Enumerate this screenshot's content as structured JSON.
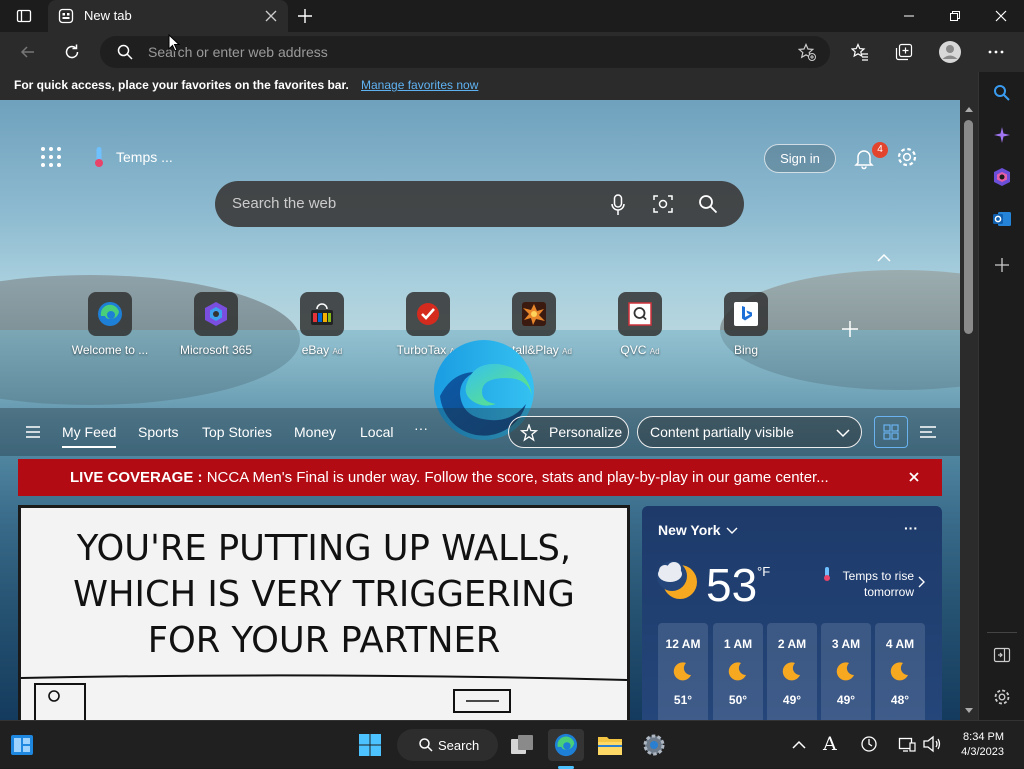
{
  "browser": {
    "tab_title": "New tab",
    "address_placeholder": "Search or enter web address",
    "favbar_text": "For quick access, place your favorites on the favorites bar.",
    "favbar_link": "Manage favorites now"
  },
  "newtab": {
    "weather_temp_label": "Temps ...",
    "sign_in": "Sign in",
    "notification_count": "4",
    "search_placeholder": "Search the web",
    "tiles": [
      {
        "label": "Welcome to ...",
        "ad": "",
        "icon": "edge-icon"
      },
      {
        "label": "Microsoft 365",
        "ad": "",
        "icon": "m365-icon"
      },
      {
        "label": "eBay",
        "ad": "Ad",
        "icon": "ebay-icon"
      },
      {
        "label": "TurboTax",
        "ad": "Ad",
        "icon": "turbotax-icon"
      },
      {
        "label": "Install&Play",
        "ad": "Ad",
        "icon": "install-play-icon"
      },
      {
        "label": "QVC",
        "ad": "Ad",
        "icon": "qvc-icon"
      },
      {
        "label": "Bing",
        "ad": "",
        "icon": "bing-icon"
      }
    ],
    "feed_nav": [
      "My Feed",
      "Sports",
      "Top Stories",
      "Money",
      "Local"
    ],
    "more": "···",
    "personalize": "Personalize",
    "content_visibility": "Content partially visible"
  },
  "banner": {
    "label": "LIVE COVERAGE :",
    "text": "NCCA Men's Final is under way. Follow the score, stats and play-by-play in our game center..."
  },
  "comic": {
    "lines": [
      "YOU'RE PUTTING UP WALLS,",
      "WHICH IS VERY TRIGGERING",
      "FOR YOUR PARTNER"
    ]
  },
  "weather": {
    "city": "New York",
    "temp": "53",
    "unit": "°F",
    "note_line1": "Temps to rise",
    "note_line2": "tomorrow",
    "hours": [
      {
        "time": "12 AM",
        "temp": "51°"
      },
      {
        "time": "1 AM",
        "temp": "50°"
      },
      {
        "time": "2 AM",
        "temp": "49°"
      },
      {
        "time": "3 AM",
        "temp": "49°"
      },
      {
        "time": "4 AM",
        "temp": "48°"
      }
    ]
  },
  "taskbar": {
    "search_label": "Search",
    "time": "8:34 PM",
    "date": "4/3/2023"
  },
  "colors": {
    "banner_red": "#b30b13",
    "link_blue": "#5fb2f2",
    "notification_badge": "#e3442d"
  }
}
